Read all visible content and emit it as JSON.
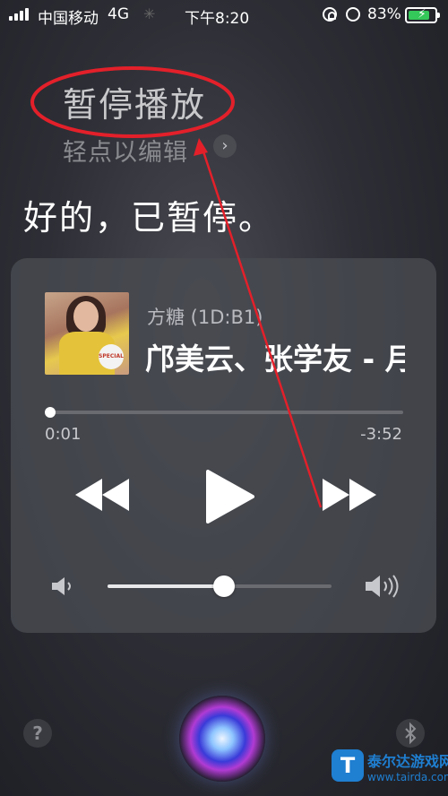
{
  "status_bar": {
    "carrier": "中国移动",
    "network": "4G",
    "time": "下午8:20",
    "battery_percent": "83%",
    "battery_level": 0.83,
    "signal_bars": 4,
    "icons": [
      "signal-icon",
      "loading-icon",
      "orientation-lock-icon",
      "alarm-icon",
      "battery-icon"
    ]
  },
  "siri": {
    "query": "暂停播放",
    "edit_hint": "轻点以编辑",
    "response": "好的，已暂停。"
  },
  "now_playing": {
    "source": "方糖 (1D:B1)",
    "title": "邝美云、张学友 - 月",
    "album_badge": "SPECIAL",
    "elapsed": "0:01",
    "remaining": "-3:52",
    "progress": 0.01,
    "volume": 0.55
  },
  "bottom": {
    "help_label": "?",
    "watermark_logo": "T",
    "watermark_name": "泰尔达游戏网",
    "watermark_url": "www.tairda.com"
  },
  "colors": {
    "background": "#2e2f36",
    "card": "#484a50",
    "annotation_red": "#e3202a",
    "battery_green": "#34c759"
  }
}
